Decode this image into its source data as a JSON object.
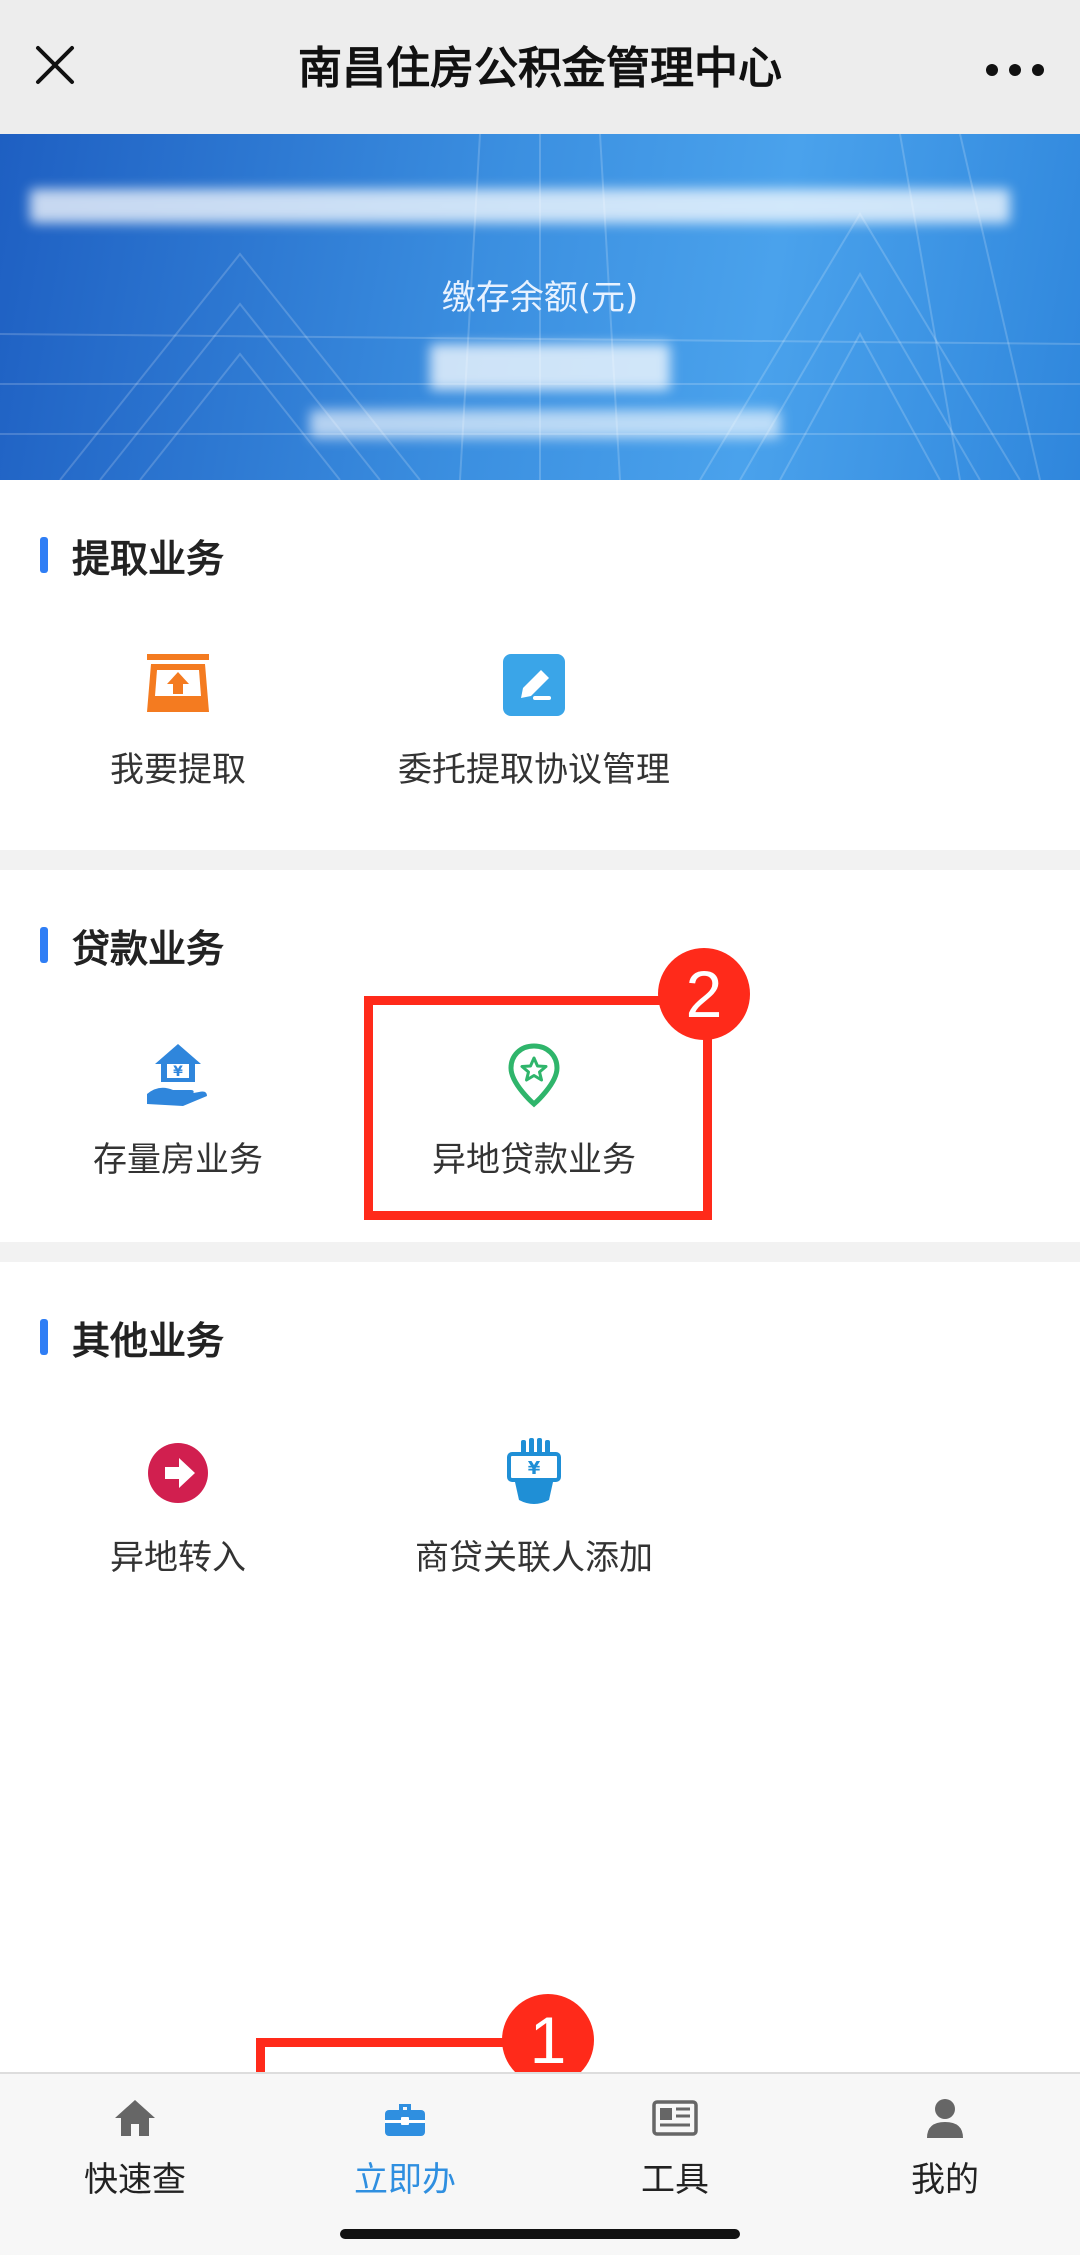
{
  "titlebar": {
    "title": "南昌住房公积金管理中心",
    "close_icon": "close-icon",
    "more_icon": "more-dots-icon"
  },
  "banner": {
    "balance_label": "缴存余额(元)"
  },
  "sections": {
    "withdraw": {
      "title": "提取业务",
      "items": [
        {
          "label": "我要提取",
          "icon": "withdraw-tray-icon"
        },
        {
          "label": "委托提取协议管理",
          "icon": "edit-pen-icon"
        }
      ]
    },
    "loan": {
      "title": "贷款业务",
      "items": [
        {
          "label": "存量房业务",
          "icon": "house-hand-icon"
        },
        {
          "label": "异地贷款业务",
          "icon": "location-star-icon"
        }
      ]
    },
    "other": {
      "title": "其他业务",
      "items": [
        {
          "label": "异地转入",
          "icon": "arrow-circle-icon"
        },
        {
          "label": "商贷关联人添加",
          "icon": "yuan-hand-icon"
        }
      ]
    }
  },
  "annotations": {
    "badge1": "1",
    "badge2": "2"
  },
  "tabbar": {
    "tabs": [
      {
        "label": "快速查",
        "icon": "home-icon"
      },
      {
        "label": "立即办",
        "icon": "briefcase-icon",
        "active": true
      },
      {
        "label": "工具",
        "icon": "newspaper-icon"
      },
      {
        "label": "我的",
        "icon": "person-icon"
      }
    ]
  },
  "colors": {
    "accent": "#2f7ef5",
    "active_tab": "#2f8fe0",
    "highlight": "#ff2a1a",
    "banner": "#3b8fe0"
  }
}
